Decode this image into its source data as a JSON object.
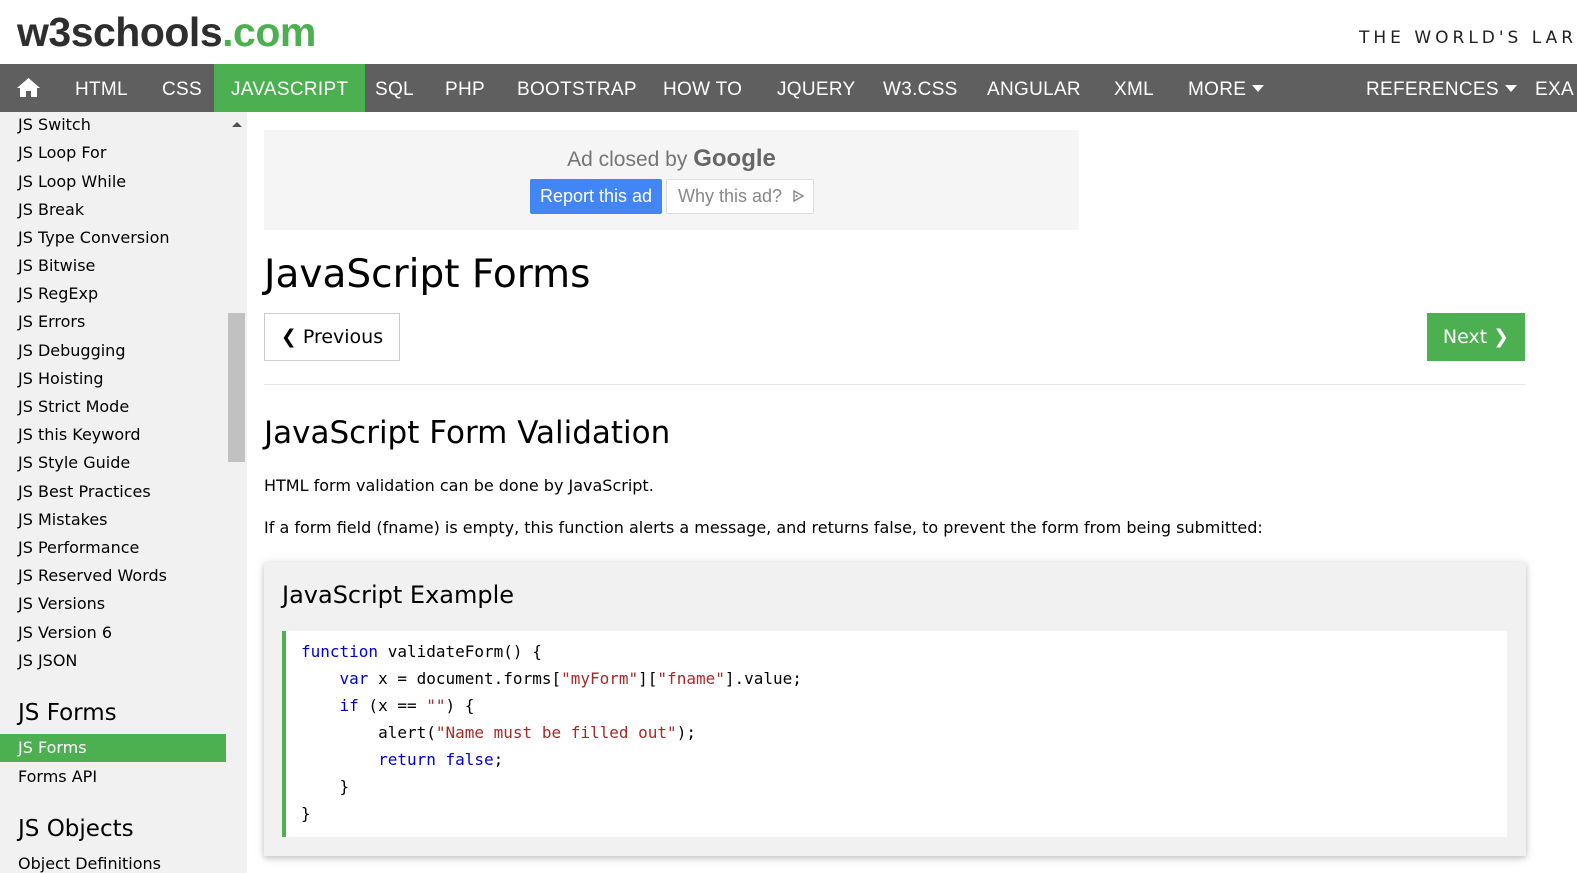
{
  "header": {
    "logo_main": "w3schools",
    "logo_tld": ".com",
    "tagline": "THE WORLD'S LARG"
  },
  "nav": {
    "items": [
      "HTML",
      "CSS",
      "JAVASCRIPT",
      "SQL",
      "PHP",
      "BOOTSTRAP",
      "HOW TO",
      "JQUERY",
      "W3.CSS",
      "ANGULAR",
      "XML",
      "MORE",
      "REFERENCES",
      "EXA"
    ],
    "active": "JAVASCRIPT",
    "home_icon": "home-icon",
    "dropdown_icon": "caret-down-icon"
  },
  "sidebar": {
    "links": [
      "JS Switch",
      "JS Loop For",
      "JS Loop While",
      "JS Break",
      "JS Type Conversion",
      "JS Bitwise",
      "JS RegExp",
      "JS Errors",
      "JS Debugging",
      "JS Hoisting",
      "JS Strict Mode",
      "JS this Keyword",
      "JS Style Guide",
      "JS Best Practices",
      "JS Mistakes",
      "JS Performance",
      "JS Reserved Words",
      "JS Versions",
      "JS Version 6",
      "JS JSON"
    ],
    "forms_heading": "JS Forms",
    "forms_active": "JS Forms",
    "forms_links": [
      "Forms API"
    ],
    "objects_heading": "JS Objects",
    "objects_links": [
      "Object Definitions"
    ]
  },
  "ad": {
    "closed_prefix": "Ad closed by",
    "closed_brand": "Google",
    "report_label": "Report this ad",
    "why_label": "Why this ad?",
    "why_icon": "adchoices-icon",
    "colors": {
      "report": "#4285f4"
    }
  },
  "main": {
    "title": "JavaScript Forms",
    "prev_label": "❮ Previous",
    "next_label": "Next ❯",
    "section_title": "JavaScript Form Validation",
    "para1": "HTML form validation can be done by JavaScript.",
    "para2": "If a form field (fname) is empty, this function alerts a message, and returns false, to prevent the form from being submitted:",
    "example_title": "JavaScript Example",
    "code": {
      "l1_kw": "function",
      "l1_rest": " validateForm() {",
      "l2_kw": "var",
      "l2_a": " x = document.forms[",
      "l2_s1": "\"myForm\"",
      "l2_b": "][",
      "l2_s2": "\"fname\"",
      "l2_c": "].value;",
      "l3_kw": "if",
      "l3_a": " (x == ",
      "l3_s": "\"\"",
      "l3_b": ") {",
      "l4_a": "alert(",
      "l4_s": "\"Name must be filled out\"",
      "l4_b": ");",
      "l5_kw1": "return",
      "l5_sp": " ",
      "l5_kw2": "false",
      "l5_end": ";",
      "l6": "}",
      "l7": "}"
    }
  },
  "colors": {
    "accent": "#4CAF50",
    "nav_bg": "#5f5f5f",
    "sidebar_bg": "#f1f1f1"
  }
}
